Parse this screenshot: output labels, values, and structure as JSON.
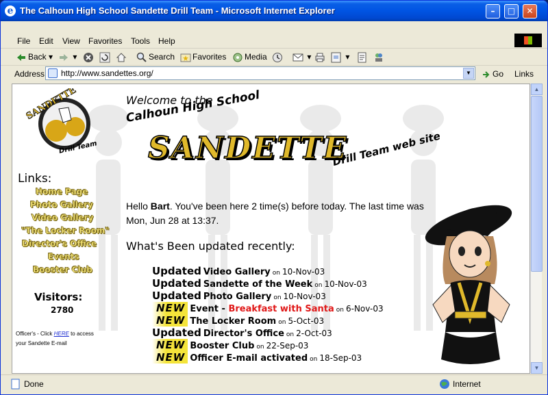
{
  "window": {
    "title": "The Calhoun High School Sandette Drill Team - Microsoft Internet Explorer",
    "minimize": "–",
    "maximize": "□",
    "close": "✕"
  },
  "menu": [
    "File",
    "Edit",
    "View",
    "Favorites",
    "Tools",
    "Help"
  ],
  "toolbar": {
    "back": "Back",
    "search": "Search",
    "favorites": "Favorites",
    "media": "Media"
  },
  "address": {
    "label": "Address",
    "url": "http://www.sandettes.org/",
    "go": "Go",
    "links": "Links"
  },
  "page": {
    "logo": {
      "line1": "SANDETTE",
      "line2": "Drill Team"
    },
    "links_heading": "Links:",
    "nav": [
      "Home Page",
      "Photo Gallery",
      "Video Gallery",
      "\"The Locker Room\"",
      "Director's Office",
      "Events",
      "Booster Club"
    ],
    "visitors_heading": "Visitors:",
    "visitor_count": "2780",
    "officer_note_pre": "Officer's - Click ",
    "officer_note_link": "HERE",
    "officer_note_post": " to access your Sandette E-mail",
    "welcome": "Welcome to the",
    "banner_school": "Calhoun High School",
    "banner_name": "SANDETTE",
    "banner_tag": "Drill Team web site",
    "greeting_hello": "Hello ",
    "greeting_name": "Bart",
    "greeting_rest": ". You've been here 2 time(s) before today. The last time was Mon, Jun 28 at 13:37.",
    "recent_heading": "What's Been updated recently:",
    "updates": [
      {
        "badge": "Updated",
        "kind": "updated",
        "item": "Video Gallery",
        "on": "on",
        "date": "10-Nov-03"
      },
      {
        "badge": "Updated",
        "kind": "updated",
        "item": "Sandette of the Week",
        "on": "on",
        "date": "10-Nov-03"
      },
      {
        "badge": "Updated",
        "kind": "updated",
        "item": "Photo Gallery",
        "on": "on",
        "date": "10-Nov-03"
      },
      {
        "badge": "NEW",
        "kind": "new",
        "item": "Event - ",
        "link": "Breakfast with Santa",
        "on": "on",
        "date": "6-Nov-03"
      },
      {
        "badge": "NEW",
        "kind": "new",
        "item": "The Locker Room",
        "on": "on",
        "date": "5-Oct-03"
      },
      {
        "badge": "Updated",
        "kind": "updated",
        "item": "Director's Office",
        "on": "on",
        "date": "2-Oct-03"
      },
      {
        "badge": "NEW",
        "kind": "new",
        "item": "Booster Club",
        "on": "on",
        "date": "22-Sep-03"
      },
      {
        "badge": "NEW",
        "kind": "new",
        "item": "Officer E-mail activated",
        "on": "on",
        "date": "18-Sep-03"
      }
    ]
  },
  "status": {
    "text": "Done",
    "zone": "Internet"
  },
  "colors": {
    "titlebar": "#0054e3",
    "nav_gold": "#f7e77a",
    "new_highlight": "#f4e43a",
    "event_link": "#e01818",
    "banner_gold": "#e0b92b"
  },
  "icons": [
    "ie-icon",
    "back-arrow-icon",
    "forward-arrow-icon",
    "stop-icon",
    "refresh-icon",
    "home-icon",
    "search-icon",
    "favorites-icon",
    "media-icon",
    "history-icon",
    "mail-icon",
    "print-icon",
    "edit-icon",
    "discuss-icon",
    "messenger-icon",
    "page-icon",
    "go-arrow-icon",
    "globe-icon",
    "windows-flag-icon"
  ]
}
